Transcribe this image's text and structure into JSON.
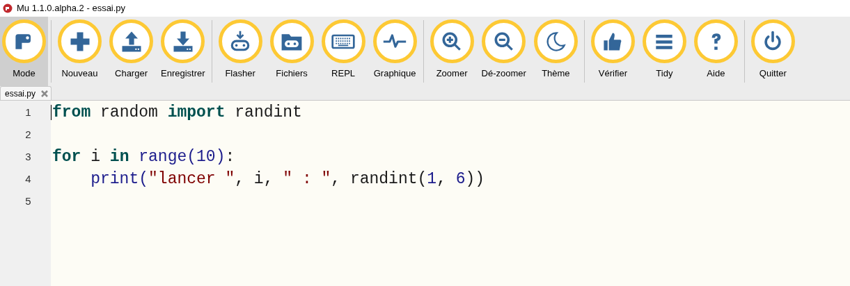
{
  "window": {
    "title": "Mu 1.1.0.alpha.2 - essai.py"
  },
  "toolbar": {
    "groups": [
      [
        {
          "label": "Mode",
          "selected": true
        }
      ],
      [
        {
          "label": "Nouveau",
          "selected": false
        },
        {
          "label": "Charger",
          "selected": false
        },
        {
          "label": "Enregistrer",
          "selected": false
        }
      ],
      [
        {
          "label": "Flasher",
          "selected": false
        },
        {
          "label": "Fichiers",
          "selected": false
        },
        {
          "label": "REPL",
          "selected": false
        },
        {
          "label": "Graphique",
          "selected": false
        }
      ],
      [
        {
          "label": "Zoomer",
          "selected": false
        },
        {
          "label": "Dé-zoomer",
          "selected": false
        },
        {
          "label": "Thème",
          "selected": false
        }
      ],
      [
        {
          "label": "Vérifier",
          "selected": false
        },
        {
          "label": "Tidy",
          "selected": false
        },
        {
          "label": "Aide",
          "selected": false
        }
      ],
      [
        {
          "label": "Quitter",
          "selected": false
        }
      ]
    ]
  },
  "tabs": [
    {
      "label": "essai.py",
      "selected": true
    }
  ],
  "editor": {
    "lines": [
      {
        "number": "1",
        "tokens": [
          {
            "kind": "keyword",
            "text": "from"
          },
          {
            "kind": "plain",
            "text": " random "
          },
          {
            "kind": "keyword",
            "text": "import"
          },
          {
            "kind": "plain",
            "text": " randint"
          }
        ]
      },
      {
        "number": "2"
      },
      {
        "number": "3",
        "tokens": [
          {
            "kind": "keyword",
            "text": "for"
          },
          {
            "kind": "plain",
            "text": " i "
          },
          {
            "kind": "keyword",
            "text": "in"
          },
          {
            "kind": "builtin",
            "text": " range(10)"
          },
          {
            "kind": "plain",
            "text": ":"
          }
        ]
      },
      {
        "number": "4",
        "tokens": [
          {
            "kind": "builtin",
            "text": "    print("
          },
          {
            "kind": "string",
            "text": "\"lancer \""
          },
          {
            "kind": "plain",
            "text": ", i, "
          },
          {
            "kind": "string",
            "text": "\" : \""
          },
          {
            "kind": "plain",
            "text": ", randint("
          },
          {
            "kind": "builtin",
            "text": "1"
          },
          {
            "kind": "plain",
            "text": ", "
          },
          {
            "kind": "builtin",
            "text": "6"
          },
          {
            "kind": "plain",
            "text": "))"
          }
        ]
      },
      {
        "number": "5"
      }
    ]
  }
}
